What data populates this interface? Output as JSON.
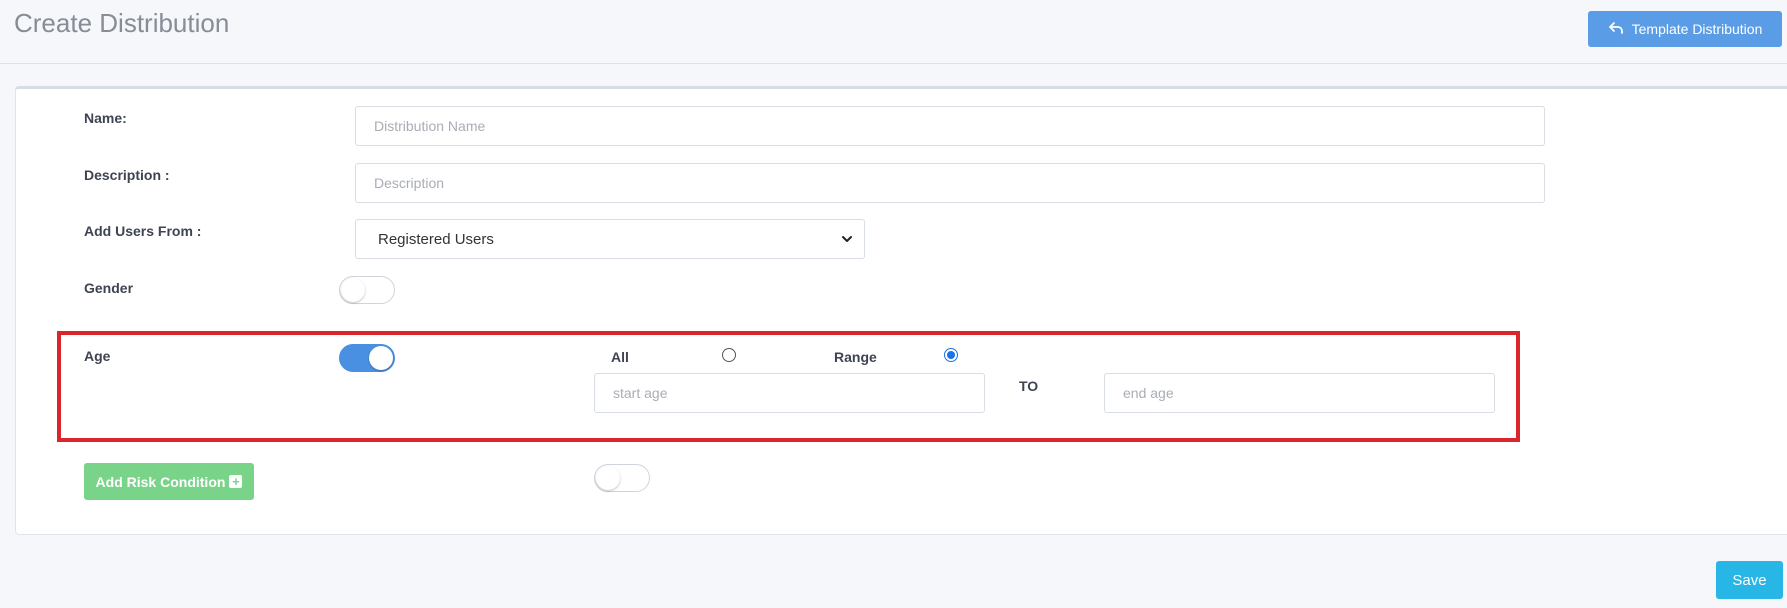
{
  "header": {
    "title": "Create Distribution",
    "template_button_label": "Template Distribution",
    "template_button_icon": "reply-arrow-icon"
  },
  "form": {
    "name": {
      "label": "Name:",
      "placeholder": "Distribution Name",
      "value": ""
    },
    "description": {
      "label": "Description :",
      "placeholder": "Description",
      "value": ""
    },
    "add_users_from": {
      "label": "Add Users From :",
      "selected": "Registered Users"
    },
    "gender": {
      "label": "Gender",
      "toggle_on": false
    },
    "age": {
      "label": "Age",
      "toggle_on": true,
      "options": [
        {
          "label": "All",
          "checked": false
        },
        {
          "label": "Range",
          "checked": true
        }
      ],
      "start_placeholder": "start age",
      "to_label": "TO",
      "end_placeholder": "end age"
    },
    "risk": {
      "button_label": "Add Risk Condition",
      "toggle_on": false
    }
  },
  "footer": {
    "save_label": "Save"
  },
  "colors": {
    "primary": "#5b9ce6",
    "toggle_on": "#4a90e2",
    "success": "#79d48a",
    "info": "#27b6e6",
    "highlight": "#d9252b"
  }
}
